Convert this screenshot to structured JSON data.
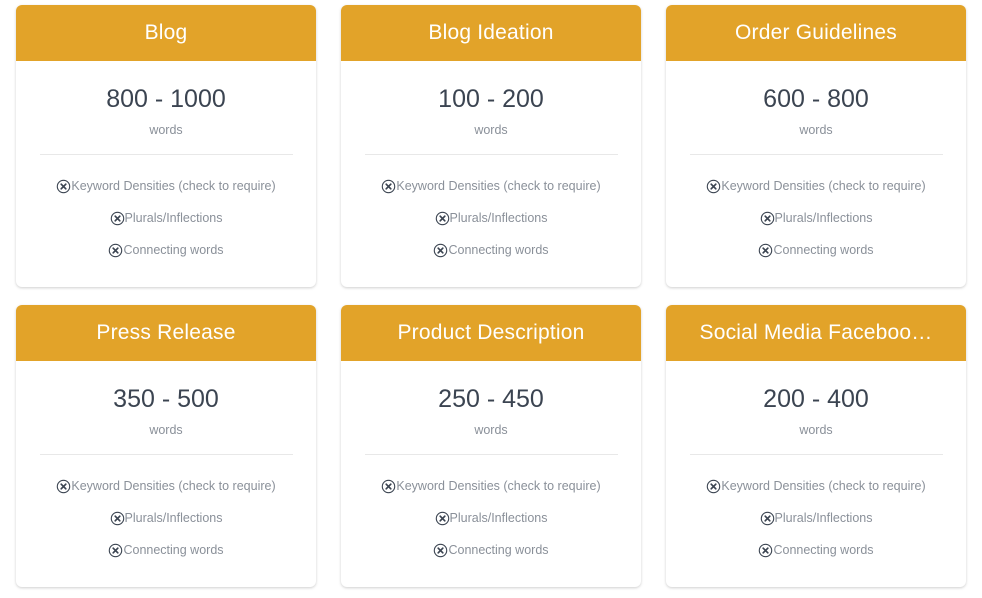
{
  "page": {
    "accent_color": "#e2a329",
    "card_background": "#ffffff",
    "page_background": "#ffffff",
    "range_text_color": "#3b4451",
    "option_text_color": "#8a9099",
    "units_label": "words"
  },
  "option_labels": {
    "keyword_densities": "Keyword Densities (check to require)",
    "plurals_inflections": "Plurals/Inflections",
    "connecting_words": "Connecting words"
  },
  "cards": [
    {
      "title": "Blog",
      "range": "800 - 1000",
      "units": "words",
      "options": [
        {
          "label": "Keyword Densities (check to require)",
          "icon": "circle-x-icon"
        },
        {
          "label": "Plurals/Inflections",
          "icon": "circle-x-icon"
        },
        {
          "label": "Connecting words",
          "icon": "circle-x-icon"
        }
      ]
    },
    {
      "title": "Blog Ideation",
      "range": "100 - 200",
      "units": "words",
      "options": [
        {
          "label": "Keyword Densities (check to require)",
          "icon": "circle-x-icon"
        },
        {
          "label": "Plurals/Inflections",
          "icon": "circle-x-icon"
        },
        {
          "label": "Connecting words",
          "icon": "circle-x-icon"
        }
      ]
    },
    {
      "title": "Order Guidelines",
      "range": "600 - 800",
      "units": "words",
      "options": [
        {
          "label": "Keyword Densities (check to require)",
          "icon": "circle-x-icon"
        },
        {
          "label": "Plurals/Inflections",
          "icon": "circle-x-icon"
        },
        {
          "label": "Connecting words",
          "icon": "circle-x-icon"
        }
      ]
    },
    {
      "title": "Press Release",
      "range": "350 - 500",
      "units": "words",
      "options": [
        {
          "label": "Keyword Densities (check to require)",
          "icon": "circle-x-icon"
        },
        {
          "label": "Plurals/Inflections",
          "icon": "circle-x-icon"
        },
        {
          "label": "Connecting words",
          "icon": "circle-x-icon"
        }
      ]
    },
    {
      "title": "Product Description",
      "range": "250 - 450",
      "units": "words",
      "options": [
        {
          "label": "Keyword Densities (check to require)",
          "icon": "circle-x-icon"
        },
        {
          "label": "Plurals/Inflections",
          "icon": "circle-x-icon"
        },
        {
          "label": "Connecting words",
          "icon": "circle-x-icon"
        }
      ]
    },
    {
      "title": "Social Media Faceboo…",
      "range": "200 - 400",
      "units": "words",
      "options": [
        {
          "label": "Keyword Densities (check to require)",
          "icon": "circle-x-icon"
        },
        {
          "label": "Plurals/Inflections",
          "icon": "circle-x-icon"
        },
        {
          "label": "Connecting words",
          "icon": "circle-x-icon"
        }
      ]
    }
  ]
}
